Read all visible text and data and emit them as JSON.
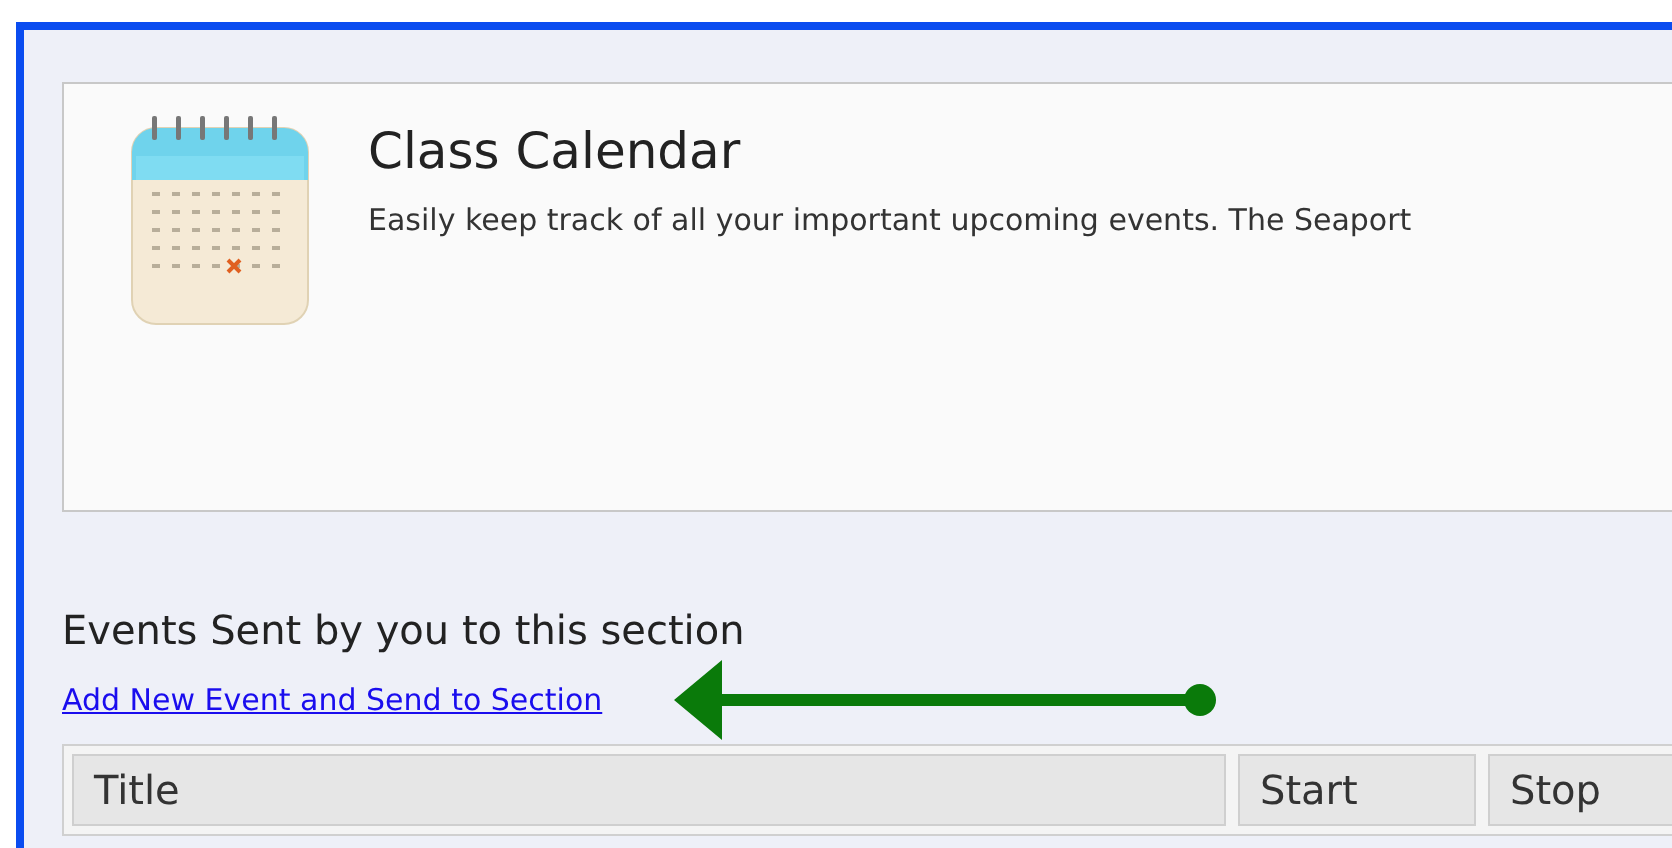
{
  "card": {
    "title": "Class Calendar",
    "description": "Easily keep track of all your important upcoming events. The Seaport"
  },
  "section": {
    "heading": "Events Sent by you to this section",
    "link": "Add New Event and Send to Section"
  },
  "table": {
    "columns": [
      "Title",
      "Start",
      "Stop"
    ]
  }
}
